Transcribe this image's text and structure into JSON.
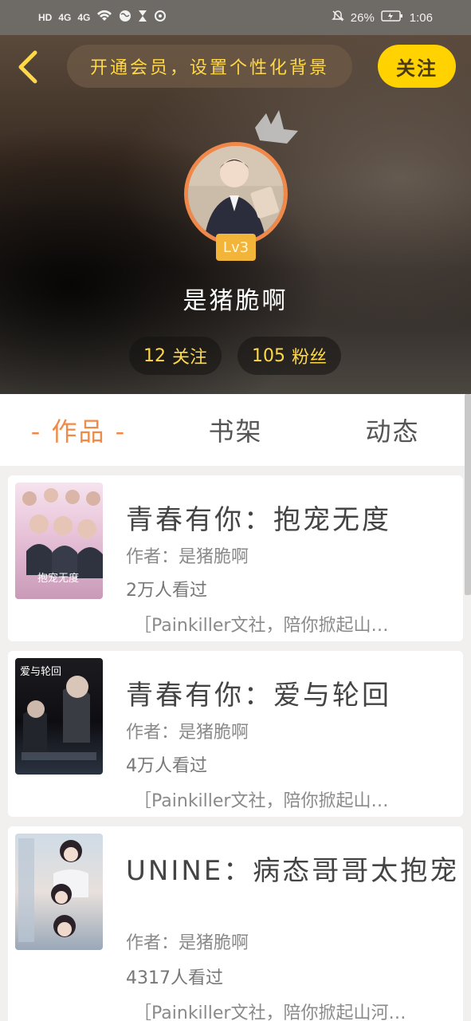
{
  "status_bar": {
    "left_icons": [
      "HD",
      "4G",
      "4G"
    ],
    "battery": "26%",
    "time": "1:06"
  },
  "header": {
    "vip_banner": "开通会员，设置个性化背景",
    "follow_label": "关注",
    "level": "Lv3",
    "username": "是猪脆啊",
    "follow_count": "12",
    "follow_text": "关注",
    "fans_count": "105",
    "fans_text": "粉丝"
  },
  "tabs": [
    {
      "label": "- 作品 -",
      "active": true
    },
    {
      "label": "书架",
      "active": false
    },
    {
      "label": "动态",
      "active": false
    }
  ],
  "works": [
    {
      "title": "青春有你：抱宠无度",
      "author": "作者：是猪脆啊",
      "views": "2万人看过",
      "desc": "［Painkiller文社，陪你掀起山…",
      "cover_caption": "抱宠无度"
    },
    {
      "title": "青春有你：爱与轮回",
      "author": "作者：是猪脆啊",
      "views": "4万人看过",
      "desc": "［Painkiller文社，陪你掀起山…",
      "cover_caption": "爱与轮回"
    },
    {
      "title": "UNINE：病态哥哥太抱宠",
      "author": "作者：是猪脆啊",
      "views": "4317人看过",
      "desc": "［Painkiller文社，陪你掀起山河…",
      "cover_caption": ""
    }
  ]
}
